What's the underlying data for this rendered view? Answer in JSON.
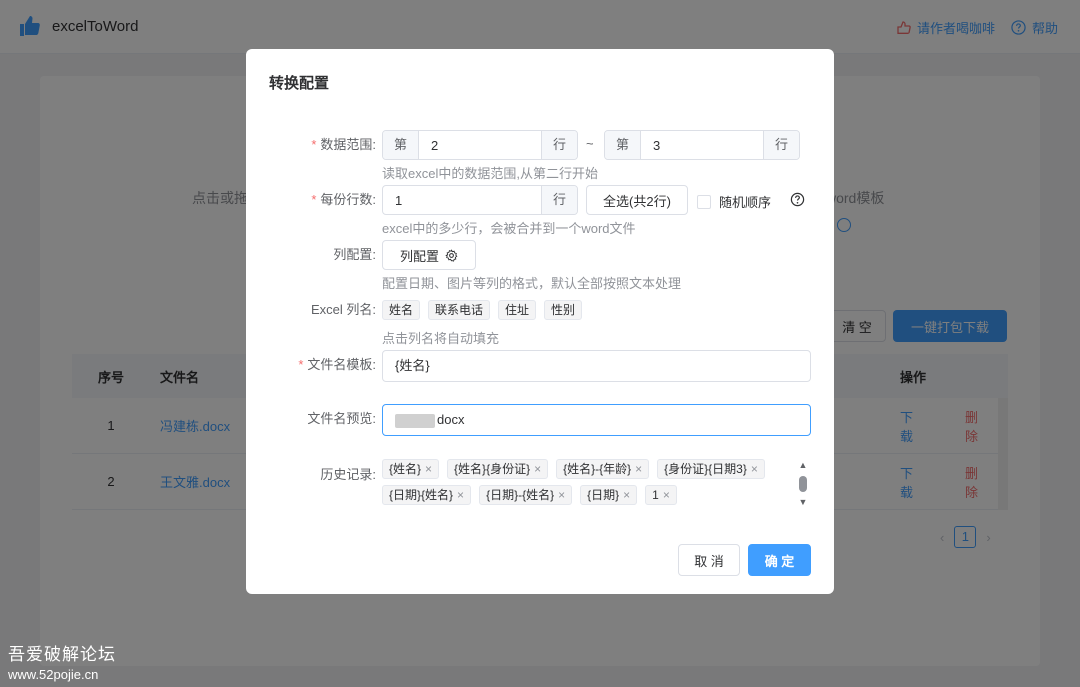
{
  "header": {
    "app_name": "excelToWord",
    "coffee_link": "请作者喝咖啡",
    "help_link": "帮助"
  },
  "background": {
    "upload_hint_left": "点击或拖",
    "upload_hint_right": "word模板",
    "clear_button": "清 空",
    "download_all_button": "一键打包下载",
    "table": {
      "columns": [
        "序号",
        "文件名",
        "操作"
      ],
      "rows": [
        {
          "no": "1",
          "name": "冯建栋.docx",
          "download": "下载",
          "delete": "删除"
        },
        {
          "no": "2",
          "name": "王文雅.docx",
          "download": "下载",
          "delete": "删除"
        }
      ]
    },
    "current_page": "1"
  },
  "dialog": {
    "title": "转换配置",
    "data_range": {
      "label": "数据范围:",
      "prefix": "第",
      "start": "2",
      "suffix": "行",
      "tilde": "~",
      "end": "3",
      "help": "读取excel中的数据范围,从第二行开始"
    },
    "rows_per_file": {
      "label": "每份行数:",
      "value": "1",
      "suffix": "行",
      "select_all": "全选(共2行)",
      "random_order": "随机顺序",
      "help": "excel中的多少行，会被合并到一个word文件"
    },
    "column_config": {
      "label": "列配置:",
      "button": "列配置",
      "help": "配置日期、图片等列的格式，默认全部按照文本处理"
    },
    "excel_columns": {
      "label": "Excel 列名:",
      "tags": [
        "姓名",
        "联系电话",
        "住址",
        "性别"
      ],
      "help": "点击列名将自动填充"
    },
    "filename_template": {
      "label": "文件名模板:",
      "value": "{姓名}"
    },
    "filename_preview": {
      "label": "文件名预览:",
      "value": "docx"
    },
    "history": {
      "label": "历史记录:",
      "row1": [
        "{姓名}",
        "{姓名}{身份证}",
        "{姓名}-{年龄}",
        "{身份证}{日期3}"
      ],
      "row2": [
        "{日期}{姓名}",
        "{日期}-{姓名}",
        "{日期}",
        "1"
      ]
    },
    "cancel": "取 消",
    "confirm": "确 定"
  },
  "watermark": {
    "line1": "吾爱破解论坛",
    "line2": "www.52pojie.cn"
  }
}
